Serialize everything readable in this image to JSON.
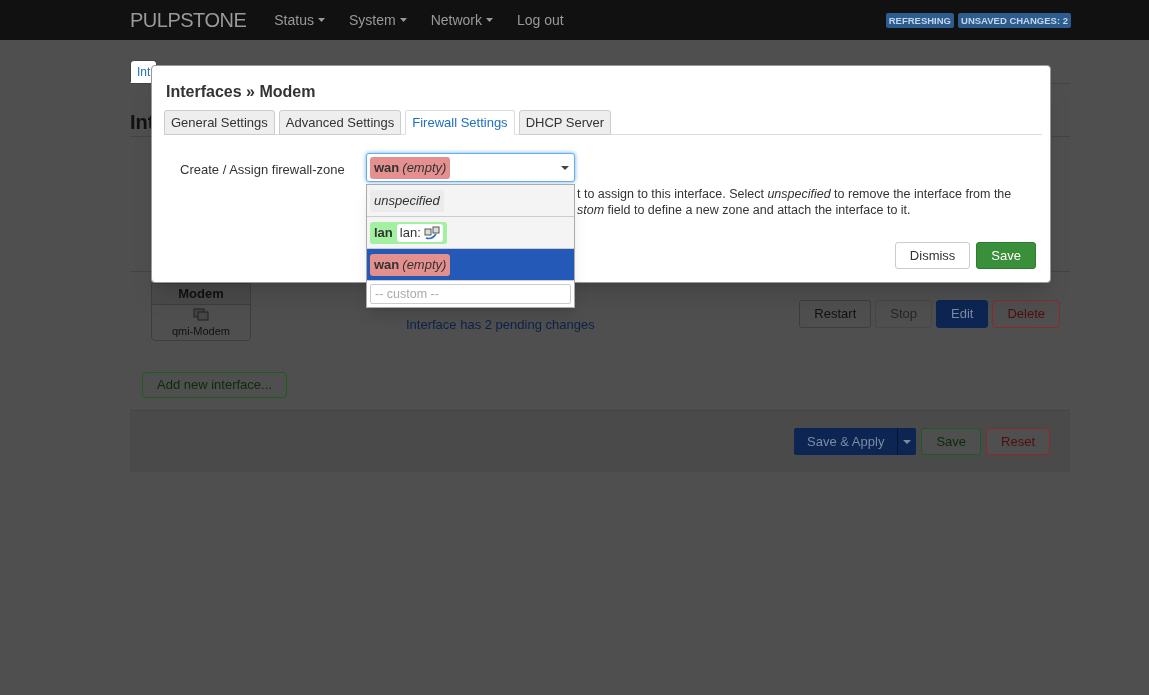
{
  "header": {
    "brand": "PULPSTONE",
    "menu": [
      {
        "label": "Status",
        "dropdown": true
      },
      {
        "label": "System",
        "dropdown": true
      },
      {
        "label": "Network",
        "dropdown": true
      },
      {
        "label": "Log out",
        "dropdown": false
      }
    ],
    "badges": [
      "REFRESHING",
      "UNSAVED CHANGES: 2"
    ]
  },
  "page": {
    "tab": {
      "label": "Int",
      "selected": true
    },
    "heading": "Int",
    "interface": {
      "name": "Modem",
      "device": "qmi-Modem",
      "pending": "Interface has 2 pending changes",
      "actions": [
        {
          "label": "Restart",
          "kind": "default",
          "disabled": false
        },
        {
          "label": "Stop",
          "kind": "default",
          "disabled": true
        },
        {
          "label": "Edit",
          "kind": "primary",
          "disabled": false
        },
        {
          "label": "Delete",
          "kind": "negative",
          "disabled": false
        }
      ]
    },
    "add_button": "Add new interface...",
    "footer_actions": [
      {
        "label": "Save & Apply",
        "kind": "primary"
      },
      {
        "label": "Save",
        "kind": "positive"
      },
      {
        "label": "Reset",
        "kind": "negative"
      }
    ]
  },
  "modal": {
    "title": "Interfaces » Modem",
    "tabs": [
      {
        "label": "General Settings",
        "selected": false
      },
      {
        "label": "Advanced Settings",
        "selected": false
      },
      {
        "label": "Firewall Settings",
        "selected": true
      },
      {
        "label": "DHCP Server",
        "selected": false
      }
    ],
    "field": {
      "label": "Create / Assign firewall-zone",
      "value": {
        "zone": "wan",
        "note": "(empty)",
        "color": "#e3908f"
      }
    },
    "help": [
      "t to assign to this interface. Select *unspecified* to remove the interface from the",
      "*stom* field to define a new zone and attach the interface to it."
    ],
    "dropdown": {
      "options": [
        {
          "kind": "plain",
          "label": "unspecified",
          "selected": false
        },
        {
          "kind": "zone",
          "zone": "lan",
          "device": "lan:",
          "color": "#a3f0a0",
          "selected": false
        },
        {
          "kind": "zone",
          "zone": "wan",
          "note": "(empty)",
          "color": "#e3908f",
          "selected": true
        }
      ],
      "custom_placeholder": "-- custom --"
    },
    "buttons": [
      {
        "label": "Dismiss",
        "kind": "default"
      },
      {
        "label": "Save",
        "kind": "positive"
      }
    ]
  }
}
